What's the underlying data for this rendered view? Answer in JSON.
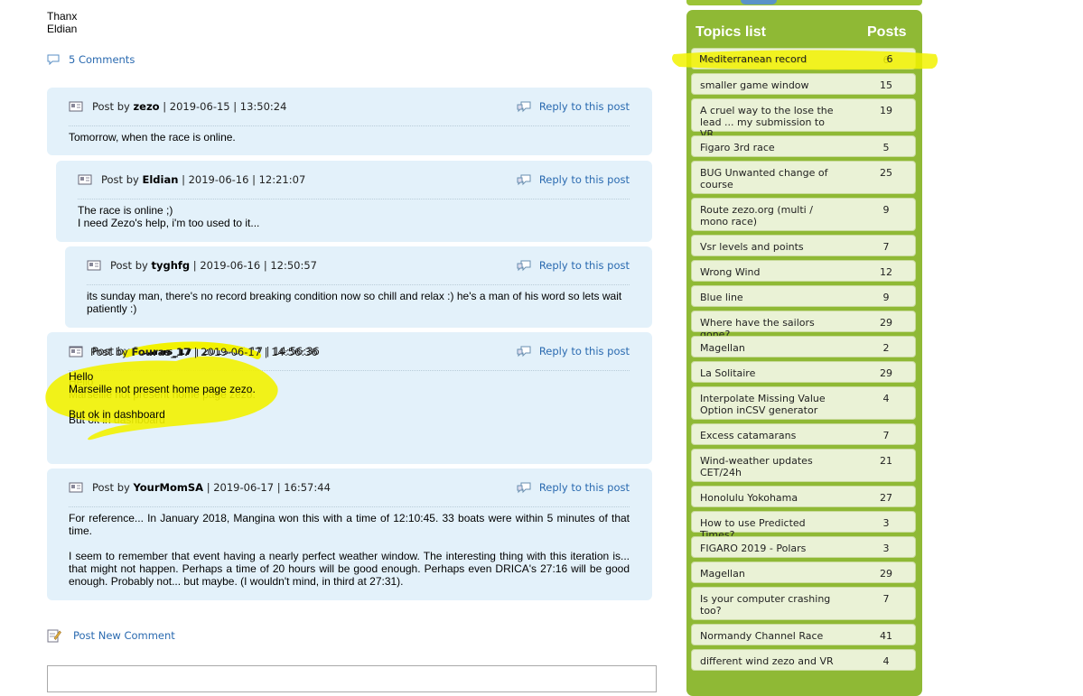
{
  "intro": {
    "line1": "Thanx",
    "line2": "Eldian"
  },
  "comments_link": {
    "label": "5 Comments"
  },
  "posts": [
    {
      "by": "Post by",
      "author": "zezo",
      "datetime": "| 2019-06-15 | 13:50:24",
      "reply": "Reply to this post",
      "body": [
        "Tomorrow, when the race is online."
      ]
    },
    {
      "by": "Post by",
      "author": "Eldian",
      "datetime": "| 2019-06-16 | 12:21:07",
      "reply": "Reply to this post",
      "body": [
        "The race is online ;)",
        "I need Zezo's help, i'm too used to it..."
      ]
    },
    {
      "by": "Post by",
      "author": "tyghfg",
      "datetime": "| 2019-06-16 | 12:50:57",
      "reply": "Reply to this post",
      "body": [
        "its sunday man, there's no record breaking condition now so chill and relax :) he's a man of his word so lets wait patiently :)"
      ]
    },
    {
      "by": "Post by",
      "author": "Fouras_17",
      "datetime": "| 2019-06-17 | 14:56:36",
      "reply": "Reply to this post",
      "body": [
        "Hello",
        "Marseille not present home page zezo.",
        "",
        "But ok in dashboard"
      ]
    },
    {
      "by": "Post by",
      "author": "YourMomSA",
      "datetime": "| 2019-06-17 | 16:57:44",
      "reply": "Reply to this post",
      "body": [
        "For reference... In January 2018, Mangina won this with a time of 12:10:45. 33 boats were within 5 minutes of that time.",
        "",
        "I seem to remember that event having a nearly perfect weather window. The interesting thing with this iteration is... that might not happen. Perhaps a time of 20 hours will be good enough. Perhaps even DRICA's 27:16 will be good enough. Probably not... but maybe. (I wouldn't mind, in third at 27:31)."
      ]
    }
  ],
  "new_comment": {
    "label": "Post New Comment"
  },
  "sidebar": {
    "title": "Topics list",
    "posts_header": "Posts",
    "topics": [
      {
        "name": "Mediterranean record",
        "count": "6"
      },
      {
        "name": "smaller game window",
        "count": "15"
      },
      {
        "name": "A cruel way to the lose the lead ... my submission to VR",
        "count": "19"
      },
      {
        "name": "Figaro 3rd race",
        "count": "5"
      },
      {
        "name": "BUG Unwanted change of course",
        "count": "25"
      },
      {
        "name": "Route zezo.org (multi / mono race)",
        "count": "9"
      },
      {
        "name": "Vsr levels and points",
        "count": "7"
      },
      {
        "name": "Wrong Wind",
        "count": "12"
      },
      {
        "name": "Blue line",
        "count": "9"
      },
      {
        "name": "Where have the sailors gone?",
        "count": "29"
      },
      {
        "name": "Magellan",
        "count": "2"
      },
      {
        "name": "La Solitaire",
        "count": "29"
      },
      {
        "name": "Interpolate Missing Value Option inCSV generator",
        "count": "4"
      },
      {
        "name": "Excess catamarans",
        "count": "7"
      },
      {
        "name": "Wind-weather updates CET/24h",
        "count": "21"
      },
      {
        "name": "Honolulu Yokohama",
        "count": "27"
      },
      {
        "name": "How to use Predicted Times?",
        "count": "3"
      },
      {
        "name": "FIGARO 2019 - Polars",
        "count": "3"
      },
      {
        "name": "Magellan",
        "count": "29"
      },
      {
        "name": "Is your computer crashing too?",
        "count": "7"
      },
      {
        "name": "Normandy Channel Race",
        "count": "41"
      },
      {
        "name": "different wind zezo and VR",
        "count": "4"
      }
    ]
  },
  "colors": {
    "link": "#2a6ab0",
    "post_bg": "#e3f1fa",
    "sidebar_green": "#8fb935",
    "topic_bg": "#eaf2d6",
    "highlight": "#f5f500"
  }
}
